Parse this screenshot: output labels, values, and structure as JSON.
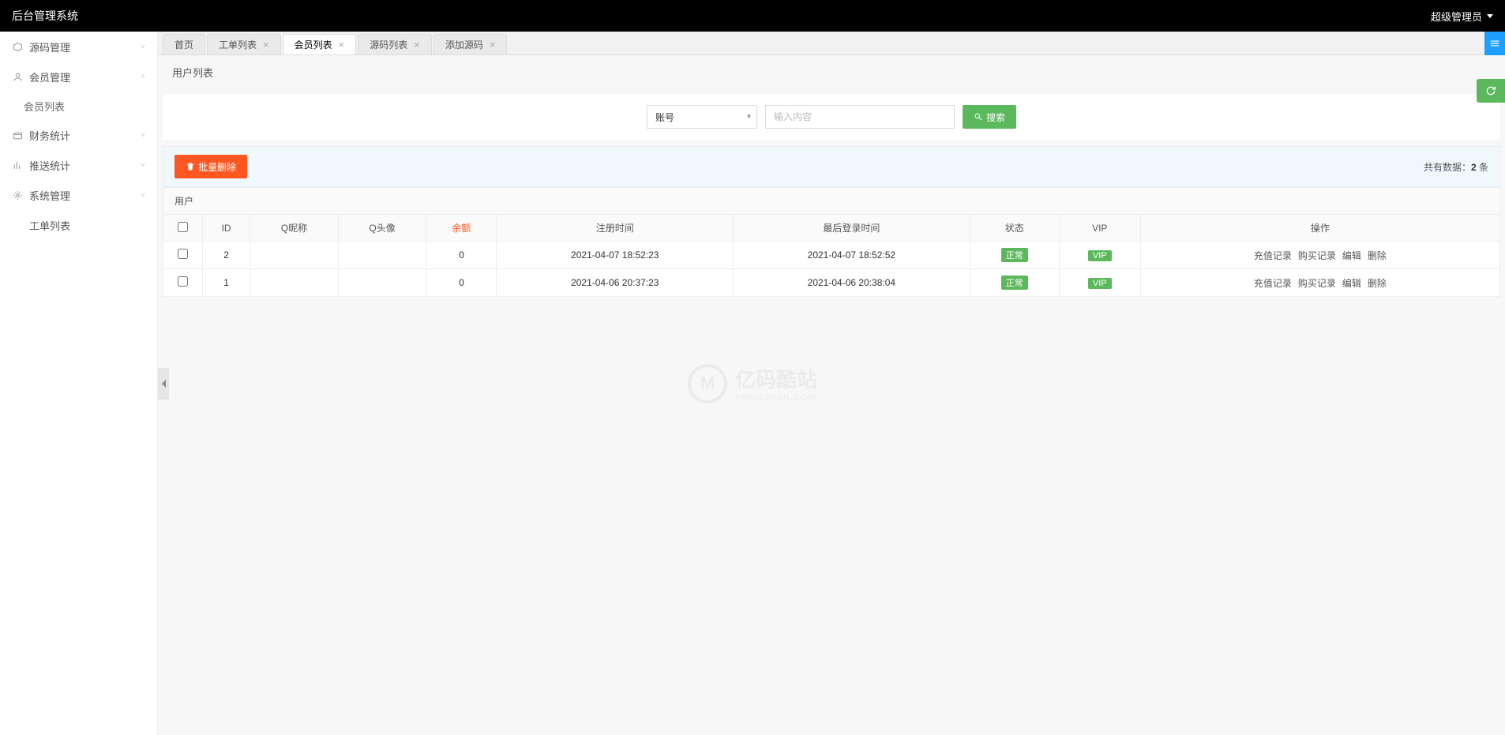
{
  "header": {
    "title": "后台管理系统",
    "user": "超级管理员"
  },
  "sidebar": {
    "items": [
      {
        "label": "源码管理",
        "icon": "box"
      },
      {
        "label": "会员管理",
        "icon": "user",
        "expanded": true,
        "children": [
          {
            "label": "会员列表"
          }
        ]
      },
      {
        "label": "财务统计",
        "icon": "wallet"
      },
      {
        "label": "推送统计",
        "icon": "chart"
      },
      {
        "label": "系统管理",
        "icon": "gear"
      },
      {
        "label": "工单列表",
        "icon": ""
      }
    ]
  },
  "tabs": [
    {
      "label": "首页",
      "closable": false
    },
    {
      "label": "工单列表",
      "closable": true
    },
    {
      "label": "会员列表",
      "closable": true,
      "active": true
    },
    {
      "label": "源码列表",
      "closable": true
    },
    {
      "label": "添加源码",
      "closable": true
    }
  ],
  "page": {
    "title": "用户列表"
  },
  "filter": {
    "select_value": "账号",
    "input_placeholder": "输入内容",
    "search_label": "搜索"
  },
  "toolbar": {
    "bulk_delete_label": "批量删除",
    "count_prefix": "共有数据：",
    "count": "2",
    "count_suffix": " 条"
  },
  "table": {
    "group_header": "用户",
    "columns": [
      "",
      "ID",
      "Q昵称",
      "Q头像",
      "余额",
      "注册时间",
      "最后登录时间",
      "状态",
      "VIP",
      "操作"
    ],
    "balance_index": 4,
    "rows": [
      {
        "id": "2",
        "nickname": "",
        "avatar": "",
        "balance": "0",
        "reg_time": "2021-04-07 18:52:23",
        "last_login": "2021-04-07 18:52:52",
        "status": "正常",
        "vip": "VIP"
      },
      {
        "id": "1",
        "nickname": "",
        "avatar": "",
        "balance": "0",
        "reg_time": "2021-04-06 20:37:23",
        "last_login": "2021-04-06 20:38:04",
        "status": "正常",
        "vip": "VIP"
      }
    ],
    "actions": [
      "充值记录",
      "购买记录",
      "编辑",
      "删除"
    ]
  },
  "watermark": {
    "name": "亿码酷站",
    "url": "YMKUZHAN.COM"
  }
}
